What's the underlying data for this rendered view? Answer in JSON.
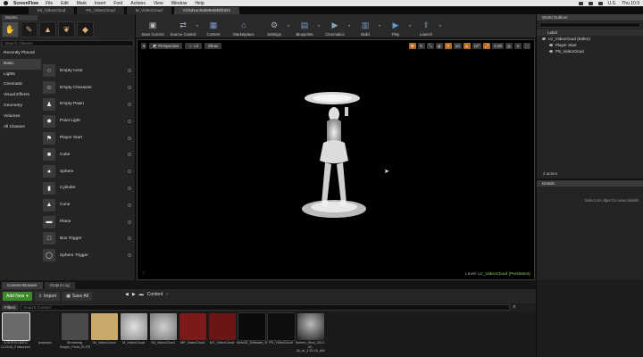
{
  "menubar": {
    "app": "ScreenFlow",
    "items": [
      "File",
      "Edit",
      "Mark",
      "Insert",
      "Font",
      "Actions",
      "View",
      "Window",
      "Help"
    ],
    "locale": "U.S.",
    "clock": "Thu 10:3"
  },
  "tabs": [
    "IM_VideoCloud",
    "PS_VideoCloud",
    "M_VideoCloud",
    "VC5d1ec0ab9840d9f2021"
  ],
  "modes": {
    "tab": "Modes",
    "search_placeholder": "Search Classes",
    "categories": [
      "Recently Placed",
      "Basic",
      "Lights",
      "Cinematic",
      "Visual Effects",
      "Geometry",
      "Volumes",
      "All Classes"
    ],
    "items": [
      {
        "label": "Empty Actor",
        "icon": "empty-actor-icon"
      },
      {
        "label": "Empty Character",
        "icon": "character-icon"
      },
      {
        "label": "Empty Pawn",
        "icon": "pawn-icon"
      },
      {
        "label": "Point Light",
        "icon": "point-light-icon"
      },
      {
        "label": "Player Start",
        "icon": "player-start-icon"
      },
      {
        "label": "Cube",
        "icon": "cube-icon"
      },
      {
        "label": "Sphere",
        "icon": "sphere-icon"
      },
      {
        "label": "Cylinder",
        "icon": "cylinder-icon"
      },
      {
        "label": "Cone",
        "icon": "cone-icon"
      },
      {
        "label": "Plane",
        "icon": "plane-icon"
      },
      {
        "label": "Box Trigger",
        "icon": "box-trigger-icon"
      },
      {
        "label": "Sphere Trigger",
        "icon": "sphere-trigger-icon"
      }
    ]
  },
  "toolbar": [
    {
      "label": "Save Current",
      "icon": "save-icon",
      "color": "#9a9a9a"
    },
    {
      "label": "Source Control",
      "icon": "source-control-icon",
      "color": "#8a9ab0"
    },
    {
      "label": "Content",
      "icon": "content-icon",
      "color": "#5a7ab0"
    },
    {
      "label": "Marketplace",
      "icon": "marketplace-icon",
      "color": "#5a7ab0"
    },
    {
      "label": "Settings",
      "icon": "settings-icon",
      "color": "#9aa0b0"
    },
    {
      "label": "Blueprints",
      "icon": "blueprints-icon",
      "color": "#5a7ab0"
    },
    {
      "label": "Cinematics",
      "icon": "cinematics-icon",
      "color": "#6a8ab0"
    },
    {
      "label": "Build",
      "icon": "build-icon",
      "color": "#5a7ab0"
    },
    {
      "label": "Play",
      "icon": "play-icon",
      "color": "#4a7ad0"
    },
    {
      "label": "Launch",
      "icon": "launch-icon",
      "color": "#6a8ab0"
    }
  ],
  "viewport": {
    "perspective": "Perspective",
    "lit": "Lit",
    "show": "Show",
    "right_controls": [
      "10",
      "10°",
      "0.25",
      "4"
    ],
    "level_label": "Level:",
    "level_name": "LV_VideoCloud (Persistent)"
  },
  "outliner": {
    "tab": "World Outliner",
    "column": "Label",
    "rows": [
      "LV_VideoCloud (Editor)",
      "Player Start",
      "PS_VideoCloud"
    ],
    "count": "2 actors"
  },
  "details": {
    "tab": "Details",
    "message": "Select an object to view details."
  },
  "content_browser": {
    "tabs": [
      "Content Browser",
      "Output Log"
    ],
    "add_new": "Add New",
    "import": "Import",
    "save_all": "Save All",
    "path": "Content",
    "filters": "Filters",
    "search_placeholder": "Search Content",
    "assets": [
      {
        "label": "IVSERS/VIDEO CLOUD_Fullscreen",
        "color": "#6a6a6a"
      },
      {
        "label": "purplepix",
        "color": "#2a2a2a"
      },
      {
        "label": "Streaming Simple_Point_ELITE_Night_Pl",
        "color": "#555"
      },
      {
        "label": "IM_VideoCloud",
        "color": "#c9a86a"
      },
      {
        "label": "M_VideoCloud",
        "color": "#bdbdbd"
      },
      {
        "label": "MI_VideoCloud",
        "color": "#9a9a9a"
      },
      {
        "label": "MP_VideoCloud",
        "color": "#7a1a1a"
      },
      {
        "label": "MT_VideoCloud",
        "color": "#7a1a1a"
      },
      {
        "label": "NewUE_Software_Renderer.uir",
        "color": "#0a0a0a"
      },
      {
        "label": "PS_VideoCloud",
        "color": "#111"
      },
      {
        "label": "Screen_Shot_2017-02-16_at_1.15.18_AM",
        "color": "#2e2e2e"
      }
    ]
  }
}
